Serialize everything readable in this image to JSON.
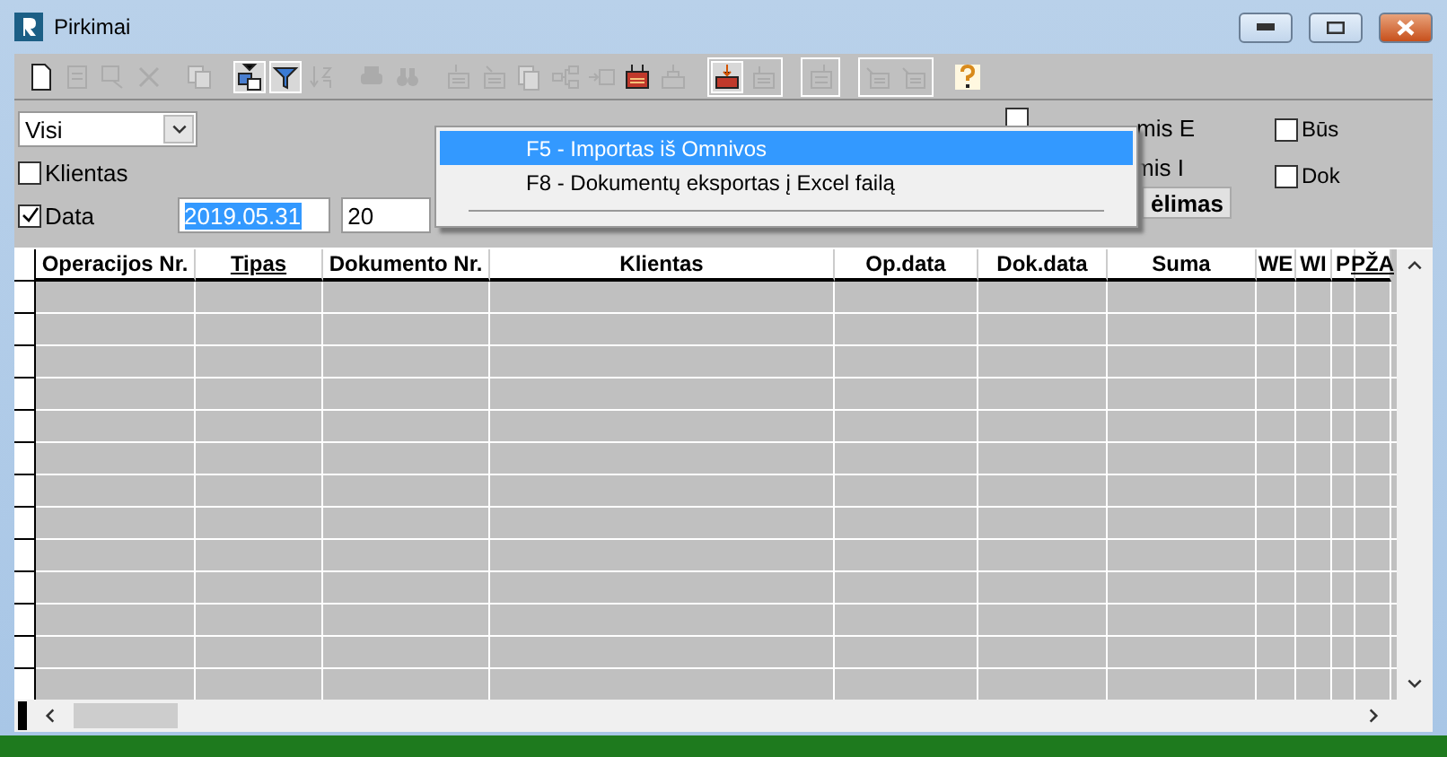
{
  "window": {
    "title": "Pirkimai"
  },
  "toolbar": {
    "groups": [
      [
        {
          "disabled": false,
          "pressed": false
        },
        {
          "disabled": true,
          "pressed": false
        },
        {
          "disabled": true,
          "pressed": false
        },
        {
          "disabled": true,
          "pressed": false
        }
      ],
      [
        {
          "disabled": true,
          "pressed": false
        }
      ],
      [
        {
          "disabled": false,
          "pressed": true
        },
        {
          "disabled": false,
          "pressed": true
        },
        {
          "disabled": true,
          "pressed": false
        }
      ],
      [
        {
          "disabled": true,
          "pressed": false
        },
        {
          "disabled": true,
          "pressed": false
        }
      ],
      [
        {
          "disabled": true,
          "pressed": false
        },
        {
          "disabled": true,
          "pressed": false
        },
        {
          "disabled": true,
          "pressed": false
        },
        {
          "disabled": true,
          "pressed": false
        },
        {
          "disabled": true,
          "pressed": false
        },
        {
          "disabled": false,
          "pressed": false
        },
        {
          "disabled": true,
          "pressed": false
        }
      ],
      [
        {
          "disabled": false,
          "pressed": true
        },
        {
          "disabled": true,
          "pressed": false
        }
      ],
      [
        {
          "disabled": true,
          "pressed": false
        }
      ],
      [
        {
          "disabled": true,
          "pressed": false
        },
        {
          "disabled": true,
          "pressed": false
        }
      ],
      [
        {
          "disabled": false,
          "pressed": false
        }
      ]
    ]
  },
  "filters": {
    "dropdown": {
      "value": "Visi"
    },
    "client": {
      "label": "Klientas",
      "checked": false
    },
    "date": {
      "label": "Data",
      "checked": true,
      "from": "2019.05.31",
      "to": "20"
    },
    "middle": {
      "checkbox": {
        "checked": false
      },
      "label_1": "mis E",
      "label_2": "mis I",
      "button": "ėlimas"
    },
    "right": [
      {
        "label": "Būs",
        "checked": false
      },
      {
        "label": "Dok",
        "checked": false
      }
    ]
  },
  "menu": {
    "items": [
      {
        "label": "F5 - Importas iš Omnivos",
        "selected": true
      },
      {
        "label": "F8 - Dokumentų eksportas į Excel failą",
        "selected": false
      }
    ]
  },
  "table": {
    "columns": [
      {
        "label": "Operacijos Nr.",
        "sorted": false
      },
      {
        "label": "Tipas",
        "sorted": true
      },
      {
        "label": "Dokumento Nr.",
        "sorted": false
      },
      {
        "label": "Klientas",
        "sorted": false
      },
      {
        "label": "Op.data",
        "sorted": false
      },
      {
        "label": "Dok.data",
        "sorted": false
      },
      {
        "label": "Suma",
        "sorted": false
      },
      {
        "label": "WE",
        "sorted": false
      },
      {
        "label": "WI",
        "sorted": false
      },
      {
        "label": "P",
        "sorted": false
      },
      {
        "label": "PŽA",
        "sorted": true
      }
    ]
  }
}
